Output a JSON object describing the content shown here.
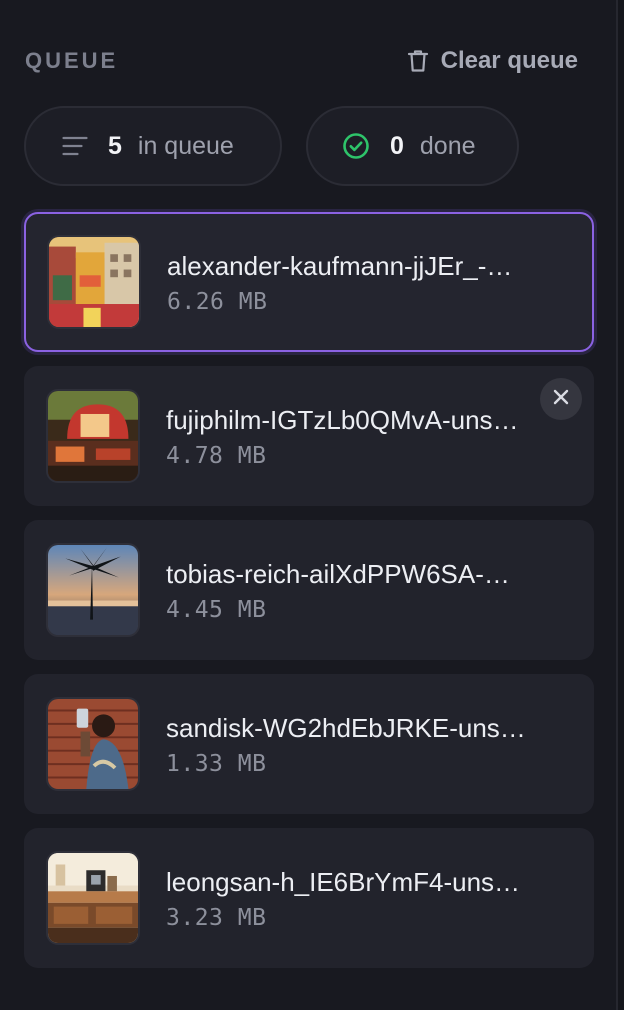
{
  "header": {
    "title": "QUEUE",
    "clear_label": "Clear queue"
  },
  "stats": {
    "queued_count": "5",
    "queued_label": "in queue",
    "done_count": "0",
    "done_label": "done"
  },
  "colors": {
    "accent": "#8b62e3",
    "success": "#2ec46a"
  },
  "items": [
    {
      "name": "alexander-kaufmann-jjJEr_-…",
      "size": "6.26 MB",
      "selected": true
    },
    {
      "name": "fujiphilm-IGTzLb0QMvA-uns…",
      "size": "4.78 MB",
      "remove_icon": "close-icon"
    },
    {
      "name": "tobias-reich-ailXdPPW6SA-…",
      "size": "4.45 MB"
    },
    {
      "name": "sandisk-WG2hdEbJRKE-uns…",
      "size": "1.33 MB"
    },
    {
      "name": "leongsan-h_IE6BrYmF4-uns…",
      "size": "3.23 MB"
    }
  ]
}
